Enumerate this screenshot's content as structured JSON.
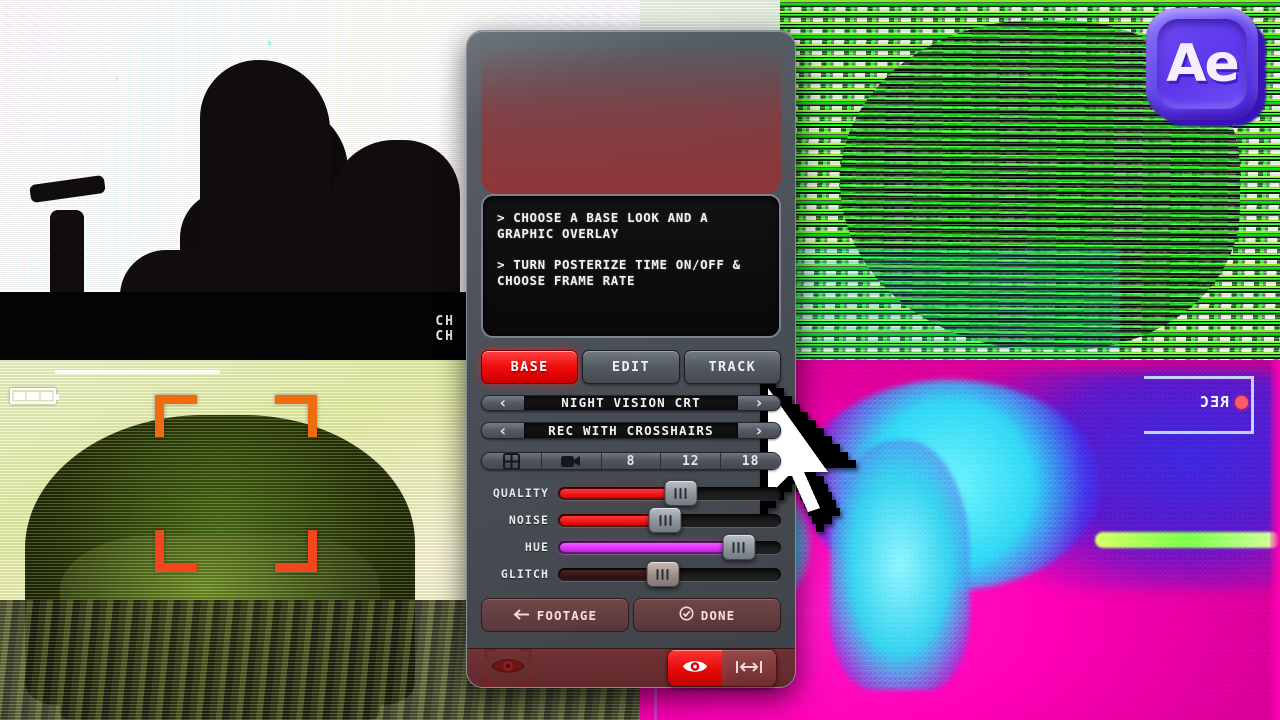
{
  "panel": {
    "readout_lines": [
      "> CHOOSE A BASE LOOK AND A GRAPHIC OVERLAY",
      "> TURN POSTERIZE TIME ON/OFF & CHOOSE FRAME RATE"
    ],
    "tabs": [
      {
        "label": "BASE",
        "active": true
      },
      {
        "label": "EDIT",
        "active": false
      },
      {
        "label": "TRACK",
        "active": false
      }
    ],
    "selectors": [
      {
        "name": "base-look",
        "value": "NIGHT VISION CRT",
        "prev": "‹",
        "next": "›"
      },
      {
        "name": "graphic-overlay",
        "value": "REC WITH CROSSHAIRS",
        "prev": "‹",
        "next": "›"
      }
    ],
    "frame_rate_row": [
      {
        "type": "icon",
        "icon": "grid-icon",
        "label": ""
      },
      {
        "type": "icon",
        "icon": "camera-icon",
        "label": ""
      },
      {
        "type": "text",
        "icon": "",
        "label": "8"
      },
      {
        "type": "text",
        "icon": "",
        "label": "12"
      },
      {
        "type": "text",
        "icon": "",
        "label": "18"
      }
    ],
    "sliders": [
      {
        "label": "QUALITY",
        "percent": 55,
        "fill_color": "#ff1111"
      },
      {
        "label": "NOISE",
        "percent": 48,
        "fill_color": "#ff1111"
      },
      {
        "label": "HUE",
        "percent": 81,
        "fill_color": "#e23bff"
      },
      {
        "label": "GLITCH",
        "percent": 47,
        "fill_color": "#3a1a1a"
      }
    ],
    "actions": [
      {
        "label": "FOOTAGE",
        "icon": "arrow-left-icon"
      },
      {
        "label": "DONE",
        "icon": "check-circle-icon"
      }
    ],
    "footer": {
      "preview_icon": "eye-target-icon",
      "record_icon": "record-eye-icon",
      "fit_icon": "fit-width-icon"
    }
  },
  "overlays": {
    "ae_logo_text": "Ae",
    "top_left_channel_text": "CH\nCH",
    "bottom_right_rec_label": "REC"
  },
  "colors": {
    "accent_red": "#ff1111",
    "accent_magenta": "#e23bff",
    "panel_body": "#4a5058",
    "ae_purple": "#5733e8",
    "viewfinder_orange": "#f06a10"
  }
}
